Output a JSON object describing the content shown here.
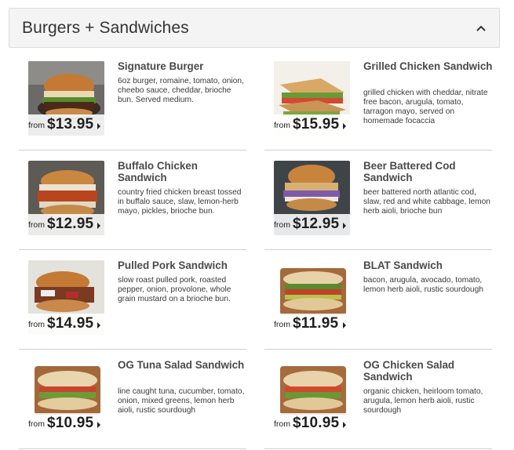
{
  "section": {
    "title": "Burgers + Sandwiches",
    "collapse_icon": "chevron-up-icon"
  },
  "items": [
    {
      "title": "Signature Burger",
      "description": "6oz burger, romaine, tomato, onion, cheebo sauce, cheddar, brioche bun. Served medium.",
      "price_prefix": "from",
      "price": "$13.95"
    },
    {
      "title": "Grilled Chicken Sandwich",
      "description": "grilled chicken with cheddar, nitrate free bacon, arugula, tomato, tarragon mayo, served on homemade focaccia",
      "price_prefix": "from",
      "price": "$15.95"
    },
    {
      "title": "Buffalo Chicken Sandwich",
      "description": "country fried chicken breast tossed in buffalo sauce, slaw, lemon-herb mayo, pickles, brioche bun.",
      "price_prefix": "from",
      "price": "$12.95"
    },
    {
      "title": "Beer Battered Cod Sandwich",
      "description": "beer battered north atlantic cod, slaw, red and white cabbage, lemon herb aioli, brioche bun",
      "price_prefix": "from",
      "price": "$12.95"
    },
    {
      "title": "Pulled Pork Sandwich",
      "description": "slow roast pulled pork, roasted pepper, onion, provolone, whole grain mustard on a brioche bun.",
      "price_prefix": "from",
      "price": "$14.95"
    },
    {
      "title": "BLAT Sandwich",
      "description": "bacon, arugula, avocado, tomato, lemon herb aioli, rustic sourdough",
      "price_prefix": "from",
      "price": "$11.95"
    },
    {
      "title": "OG Tuna Salad Sandwich",
      "description": "line caught tuna, cucumber, tomato, onion, mixed greens, lemon herb aioli, rustic sourdough",
      "price_prefix": "from",
      "price": "$10.95"
    },
    {
      "title": "OG Chicken Salad Sandwich",
      "description": "organic chicken, heirloom tomato, arugula, lemon herb aioli, rustic sourdough",
      "price_prefix": "from",
      "price": "$10.95"
    }
  ]
}
